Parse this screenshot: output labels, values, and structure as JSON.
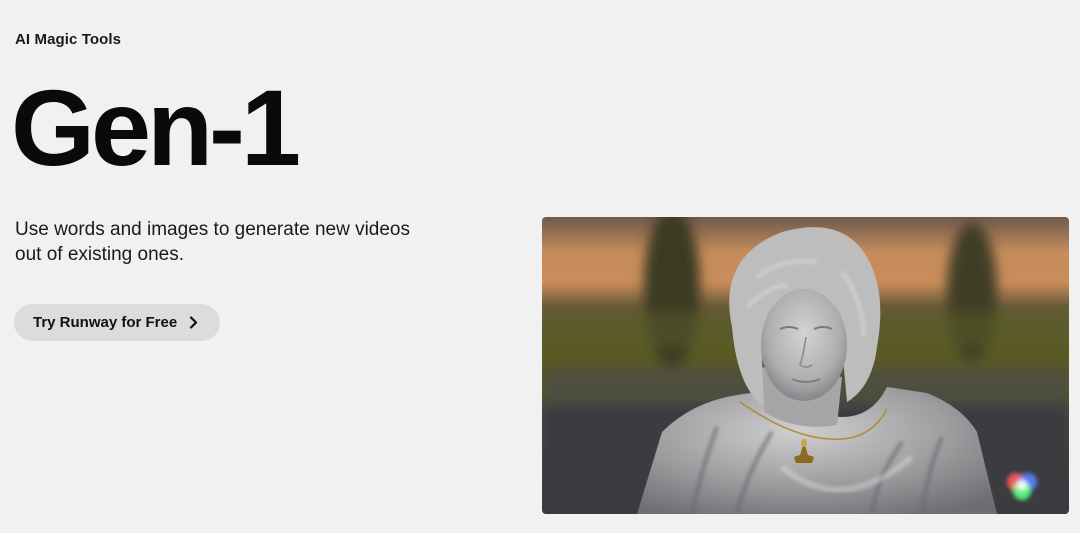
{
  "hero": {
    "eyebrow": "AI Magic Tools",
    "title": "Gen-1",
    "subtitle": "Use words and images to generate new videos out of existing ones.",
    "cta_label": "Try Runway for Free"
  },
  "media": {
    "image_alt": "Stylized statue of a woman with a pendant necklace at sunset",
    "badge_icon": "rgb-circles-icon"
  },
  "colors": {
    "background": "#f1f1f1",
    "button": "#dcdcdf",
    "text": "#0a0a0a"
  }
}
